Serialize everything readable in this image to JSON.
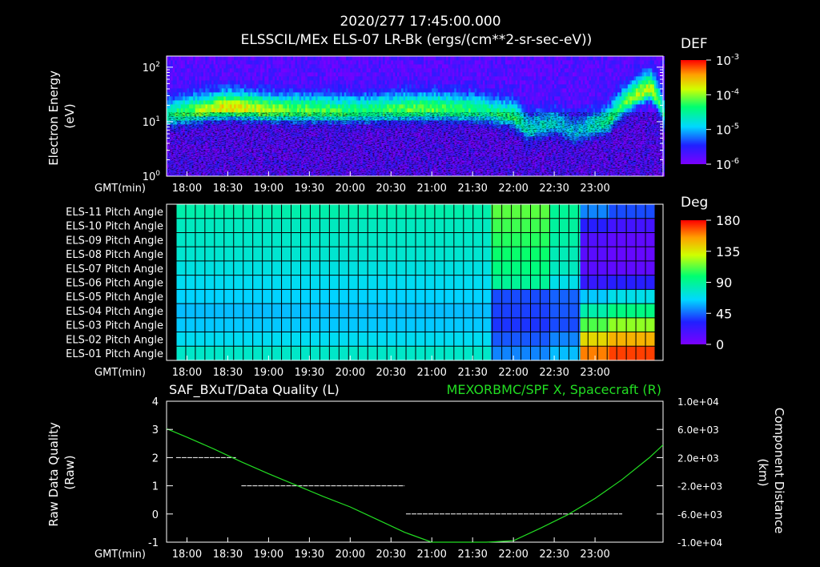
{
  "header": {
    "timestamp": "2020/277 17:45:00.000",
    "title": "ELSSCIL/MEx ELS-07 LR-Bk  (ergs/(cm**2-sr-sec-eV))"
  },
  "time_axis": {
    "label": "GMT(min)",
    "ticks": [
      "18:00",
      "18:30",
      "19:00",
      "19:30",
      "20:00",
      "20:30",
      "21:00",
      "21:30",
      "22:00",
      "22:30",
      "23:00"
    ]
  },
  "chart_data": [
    {
      "type": "heatmap",
      "name": "spectrogram",
      "ylabel": [
        "Electron Energy",
        "(eV)"
      ],
      "yscale": "log",
      "ylim": [
        1,
        160
      ],
      "yticks": [
        {
          "label": "10",
          "exp": "0",
          "value": 1
        },
        {
          "label": "10",
          "exp": "1",
          "value": 10
        },
        {
          "label": "10",
          "exp": "2",
          "value": 100
        }
      ],
      "colorbar": {
        "title": "DEF",
        "scale": "log",
        "range": [
          1e-06,
          0.001
        ],
        "ticks": [
          {
            "label": "10",
            "exp": "-3"
          },
          {
            "label": "10",
            "exp": "-4"
          },
          {
            "label": "10",
            "exp": "-5"
          },
          {
            "label": "10",
            "exp": "-6"
          }
        ]
      },
      "xrange_min": [
        1065,
        1430
      ],
      "band_profile": [
        {
          "t": 1065,
          "center_eV": 13,
          "peak": 0.55
        },
        {
          "t": 1110,
          "center_eV": 18,
          "peak": 0.9
        },
        {
          "t": 1140,
          "center_eV": 16,
          "peak": 0.75
        },
        {
          "t": 1200,
          "center_eV": 15,
          "peak": 0.6
        },
        {
          "t": 1260,
          "center_eV": 17,
          "peak": 0.7
        },
        {
          "t": 1300,
          "center_eV": 15,
          "peak": 0.55
        },
        {
          "t": 1320,
          "center_eV": 12,
          "peak": 0.6
        },
        {
          "t": 1330,
          "center_eV": 7,
          "peak": 0.45
        },
        {
          "t": 1350,
          "center_eV": 9,
          "peak": 0.4
        },
        {
          "t": 1365,
          "center_eV": 6,
          "peak": 0.35
        },
        {
          "t": 1390,
          "center_eV": 10,
          "peak": 0.55
        },
        {
          "t": 1420,
          "center_eV": 40,
          "peak": 0.85
        },
        {
          "t": 1430,
          "center_eV": 12,
          "peak": 0.5
        }
      ]
    },
    {
      "type": "heatmap",
      "name": "pitch-angle",
      "rows": [
        "ELS-11 Pitch Angle",
        "ELS-10 Pitch Angle",
        "ELS-09 Pitch Angle",
        "ELS-08 Pitch Angle",
        "ELS-07 Pitch Angle",
        "ELS-06 Pitch Angle",
        "ELS-05 Pitch Angle",
        "ELS-04 Pitch Angle",
        "ELS-03 Pitch Angle",
        "ELS-02 Pitch Angle",
        "ELS-01 Pitch Angle"
      ],
      "colorbar": {
        "title": "Deg",
        "range": [
          0,
          180
        ],
        "ticks": [
          "180",
          "135",
          "90",
          "45",
          "0"
        ]
      },
      "xrange_min": [
        1065,
        1430
      ],
      "segments": [
        {
          "t_start": 1065,
          "t_end": 1305,
          "row_values_deg": [
            85,
            80,
            78,
            76,
            72,
            68,
            64,
            60,
            62,
            68,
            78
          ]
        },
        {
          "t_start": 1305,
          "t_end": 1350,
          "row_values_deg": [
            112,
            108,
            104,
            100,
            96,
            90,
            40,
            38,
            36,
            42,
            50
          ]
        },
        {
          "t_start": 1350,
          "t_end": 1373,
          "row_values_deg": [
            90,
            88,
            86,
            82,
            80,
            70,
            44,
            42,
            40,
            50,
            60
          ]
        },
        {
          "t_start": 1373,
          "t_end": 1395,
          "row_values_deg": [
            50,
            30,
            15,
            12,
            12,
            25,
            62,
            85,
            110,
            140,
            160
          ]
        },
        {
          "t_start": 1395,
          "t_end": 1430,
          "row_values_deg": [
            40,
            20,
            10,
            8,
            10,
            30,
            70,
            95,
            120,
            150,
            170
          ]
        }
      ]
    },
    {
      "type": "line",
      "name": "data-quality",
      "title_left": "SAF_BXuT/Data Quality (L)",
      "title_right": "MEXORBMC/SPF X, Spacecraft (R)",
      "ylabel_left": [
        "Raw Data Quality",
        "(Raw)"
      ],
      "ylabel_right": [
        "Component Distance",
        "(km)"
      ],
      "ylim_left": [
        -1,
        4
      ],
      "yticks_left": [
        "4",
        "3",
        "2",
        "1",
        "0",
        "-1"
      ],
      "ylim_right": [
        -10000,
        10000
      ],
      "yticks_right": [
        "1.0e+04",
        "6.0e+03",
        "2.0e+03",
        "-2.0e+03",
        "-6.0e+03",
        "-1.0e+04"
      ],
      "series": [
        {
          "axis": "left",
          "color": "#ffffff",
          "style": "dashed",
          "segments": [
            {
              "x_start": 1072,
              "x_end": 1116,
              "y": 2
            },
            {
              "x_start": 1120,
              "x_end": 1240,
              "y": 1
            },
            {
              "x_start": 1241,
              "x_end": 1400,
              "y": 0
            }
          ]
        },
        {
          "axis": "right",
          "color": "#22dd22",
          "x_min": [
            1065,
            1080,
            1100,
            1120,
            1140,
            1160,
            1180,
            1200,
            1220,
            1240,
            1260,
            1280,
            1300,
            1320,
            1340,
            1360,
            1380,
            1400,
            1420,
            1430
          ],
          "y_km": [
            6100,
            4900,
            3200,
            1400,
            -300,
            -1900,
            -3500,
            -5000,
            -6800,
            -8600,
            -10100,
            -11700,
            -11500,
            -9800,
            -8000,
            -6100,
            -3800,
            -1100,
            2000,
            3800
          ]
        }
      ]
    }
  ]
}
